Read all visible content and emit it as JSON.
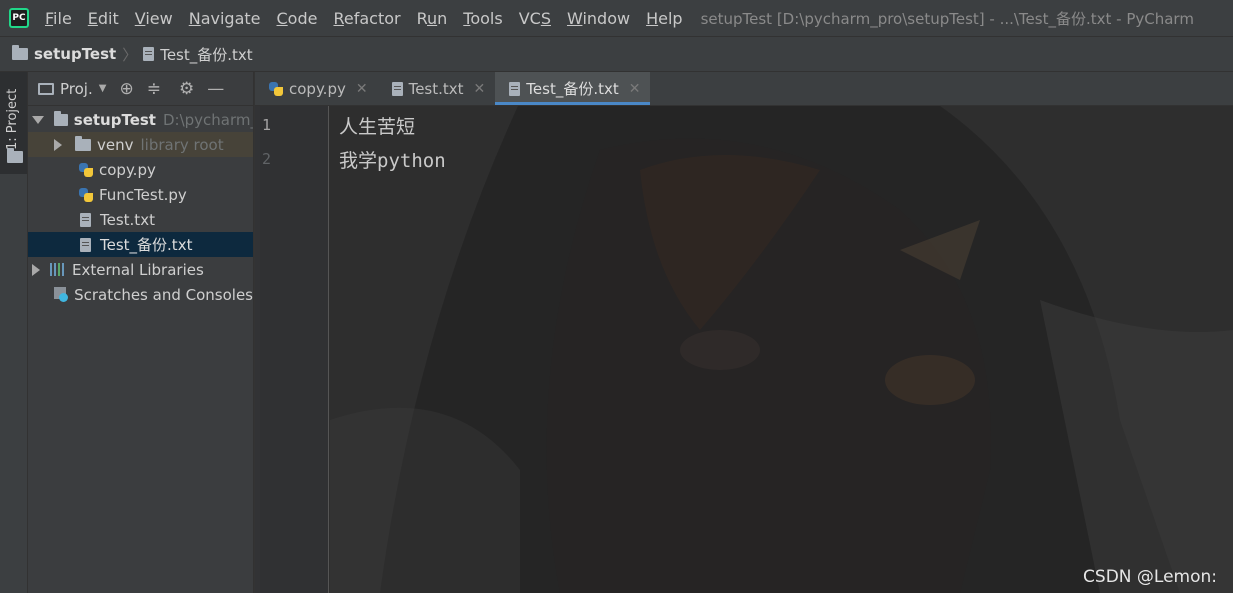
{
  "menubar": {
    "logo_text": "PC",
    "items": [
      {
        "label": "File",
        "mnemonic": "F",
        "rest": "ile"
      },
      {
        "label": "Edit",
        "mnemonic": "E",
        "rest": "dit"
      },
      {
        "label": "View",
        "mnemonic": "V",
        "rest": "iew"
      },
      {
        "label": "Navigate",
        "mnemonic": "N",
        "rest": "avigate"
      },
      {
        "label": "Code",
        "mnemonic": "C",
        "rest": "ode"
      },
      {
        "label": "Refactor",
        "mnemonic": "R",
        "rest": "efactor"
      },
      {
        "label": "Run",
        "mnemonic": "u",
        "pre": "R",
        "rest": "n"
      },
      {
        "label": "Tools",
        "mnemonic": "T",
        "rest": "ools"
      },
      {
        "label": "VCS",
        "mnemonic": "S",
        "pre": "VC",
        "rest": ""
      },
      {
        "label": "Window",
        "mnemonic": "W",
        "rest": "indow"
      },
      {
        "label": "Help",
        "mnemonic": "H",
        "rest": "elp"
      }
    ],
    "window_title": "setupTest [D:\\pycharm_pro\\setupTest] - ...\\Test_备份.txt - PyCharm"
  },
  "navbar": {
    "root": "setupTest",
    "file": "Test_备份.txt"
  },
  "tool_stripe": {
    "project_label": "1: Project"
  },
  "project_panel": {
    "dropdown_label": "Proj.",
    "icons": [
      "locate-icon",
      "collapse-icon",
      "settings-icon",
      "hide-icon"
    ],
    "tree": {
      "root_name": "setupTest",
      "root_path": "D:\\pycharm_p",
      "venv_name": "venv",
      "venv_hint": "library root",
      "files": [
        "copy.py",
        "FuncTest.py",
        "Test.txt",
        "Test_备份.txt"
      ],
      "external_libraries": "External Libraries",
      "scratches": "Scratches and Consoles"
    }
  },
  "tabs": [
    {
      "label": "copy.py",
      "type": "python",
      "active": false
    },
    {
      "label": "Test.txt",
      "type": "text",
      "active": false
    },
    {
      "label": "Test_备份.txt",
      "type": "text",
      "active": true
    }
  ],
  "editor": {
    "line_numbers": [
      "1",
      "2"
    ],
    "lines": [
      "人生苦短",
      "我学python"
    ]
  },
  "watermark": "CSDN @Lemon:",
  "colors": {
    "background": "#2b2b2b",
    "chrome": "#3c3f41",
    "selection": "#0d293e",
    "tab_underline": "#4a88c7"
  }
}
